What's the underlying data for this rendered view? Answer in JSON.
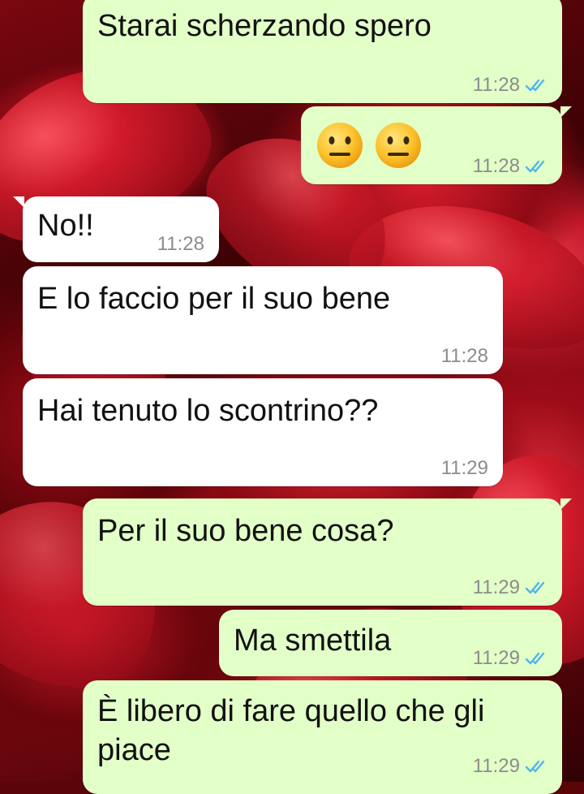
{
  "chat": {
    "messages": [
      {
        "direction": "out",
        "text": "Starai scherzando spero",
        "time": "11:28",
        "status": "read"
      },
      {
        "direction": "out",
        "emoji": [
          "neutral-face",
          "neutral-face"
        ],
        "time": "11:28",
        "status": "read"
      },
      {
        "direction": "in",
        "text": "No!!",
        "time": "11:28"
      },
      {
        "direction": "in",
        "text": "E lo faccio per il suo bene",
        "time": "11:28"
      },
      {
        "direction": "in",
        "text": "Hai tenuto lo scontrino??",
        "time": "11:29"
      },
      {
        "direction": "out",
        "text": "Per il suo bene cosa?",
        "time": "11:29",
        "status": "read"
      },
      {
        "direction": "out",
        "text": "Ma smettila",
        "time": "11:29",
        "status": "read"
      },
      {
        "direction": "out",
        "text": "È libero di fare quello che gli\npiace",
        "time": "11:29",
        "status": "read"
      }
    ]
  },
  "colors": {
    "outgoing_bubble": "#e2ffc8",
    "incoming_bubble": "#ffffff",
    "read_ticks": "#4fb6ec",
    "timestamp": "#8c8c8c",
    "wallpaper": "#b3101e"
  },
  "icons": {
    "read_receipt": "double-check-icon",
    "emoji": "neutral-face-emoji"
  }
}
